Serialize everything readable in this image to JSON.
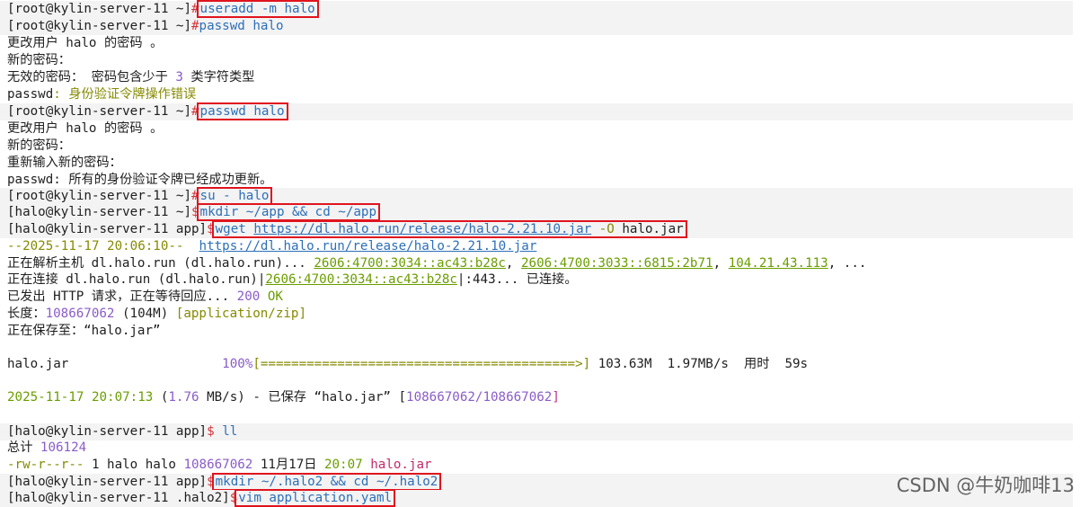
{
  "prompt_root": "[root@kylin-server-11 ~]",
  "prompt_halo_home": "[halo@kylin-server-11 ~]",
  "prompt_halo_app": "[halo@kylin-server-11 app]",
  "prompt_halo_halo2": "[halo@kylin-server-11 .halo2]",
  "hash": "#",
  "dollar": "$",
  "cmd": {
    "useradd": "useradd -m halo",
    "passwd1": "passwd halo",
    "passwd2": "passwd halo",
    "su": "su - halo",
    "mkdir_app": "mkdir ~/app && cd ~/app",
    "wget_prefix": "wget ",
    "wget_url": "https://dl.halo.run/release/halo-2.21.10.jar",
    "wget_flag": " -O",
    "wget_out": " halo.jar",
    "ll": "ll",
    "mkdir_halo2": "mkdir ~/.halo2 && cd ~/.halo2",
    "vim": "vim application.yaml"
  },
  "out": {
    "change_pw1": "更改用户 halo 的密码 。",
    "new_pw1": "新的密码：",
    "invalid_pre": "无效的密码： 密码包含少于 ",
    "invalid_num": "3",
    "invalid_post": " 类字符类型",
    "passwd_label": "passwd",
    "auth_err": ": 身份验证令牌操作错误",
    "change_pw2": "更改用户 halo 的密码 。",
    "new_pw2": "新的密码：",
    "reenter": "重新输入新的密码：",
    "passwd_label2": "passwd",
    "success": ": 所有的身份验证令牌已经成功更新。",
    "wget_time": "--2025-11-17 20:06:10--  ",
    "wget_time_url": "https://dl.halo.run/release/halo-2.21.10.jar",
    "resolving_pre": "正在解析主机 dl.halo.run (dl.halo.run)... ",
    "ip1": "2606:4700:3034::ac43:b28c",
    "comma": ", ",
    "ip2": "2606:4700:3033::6815:2b71",
    "ip3": "104.21.43.113",
    "ellipsis": ", ...",
    "connecting_pre": "正在连接 dl.halo.run (dl.halo.run)|",
    "connecting_ip": "2606:4700:3034::ac43:b28c",
    "connecting_post": "|:443... 已连接。",
    "http_pre": "已发出 HTTP 请求，正在等待回应... ",
    "http_code": "200",
    "http_ok": " OK",
    "length_pre": "长度：",
    "length_num": "108667062",
    "length_mid": " (104M) ",
    "length_type": "[application/zip]",
    "saving": "正在保存至：“halo.jar”",
    "progress_file": "halo.jar                    ",
    "progress_pct": "100%",
    "progress_bar": "[=========================================>]",
    "progress_stats": " 103.63M  1.97MB/s  用时  59s",
    "saved_date": "2025-11-17 20:07:13",
    "saved_open": " (",
    "saved_rate": "1.76",
    "saved_mid": " MB/s) - 已保存 “halo.jar” [",
    "saved_size": "108667062/108667062",
    "saved_close": "]",
    "total_pre": "总计 ",
    "total_num": "106124",
    "ls_perm": "-rw-r--r--",
    "ls_mid": " 1 halo halo ",
    "ls_size": "108667062",
    "ls_date": " 11月17日 ",
    "ls_time": "20:07",
    "ls_name": "halo.jar"
  },
  "watermark": "CSDN @牛奶咖啡13"
}
